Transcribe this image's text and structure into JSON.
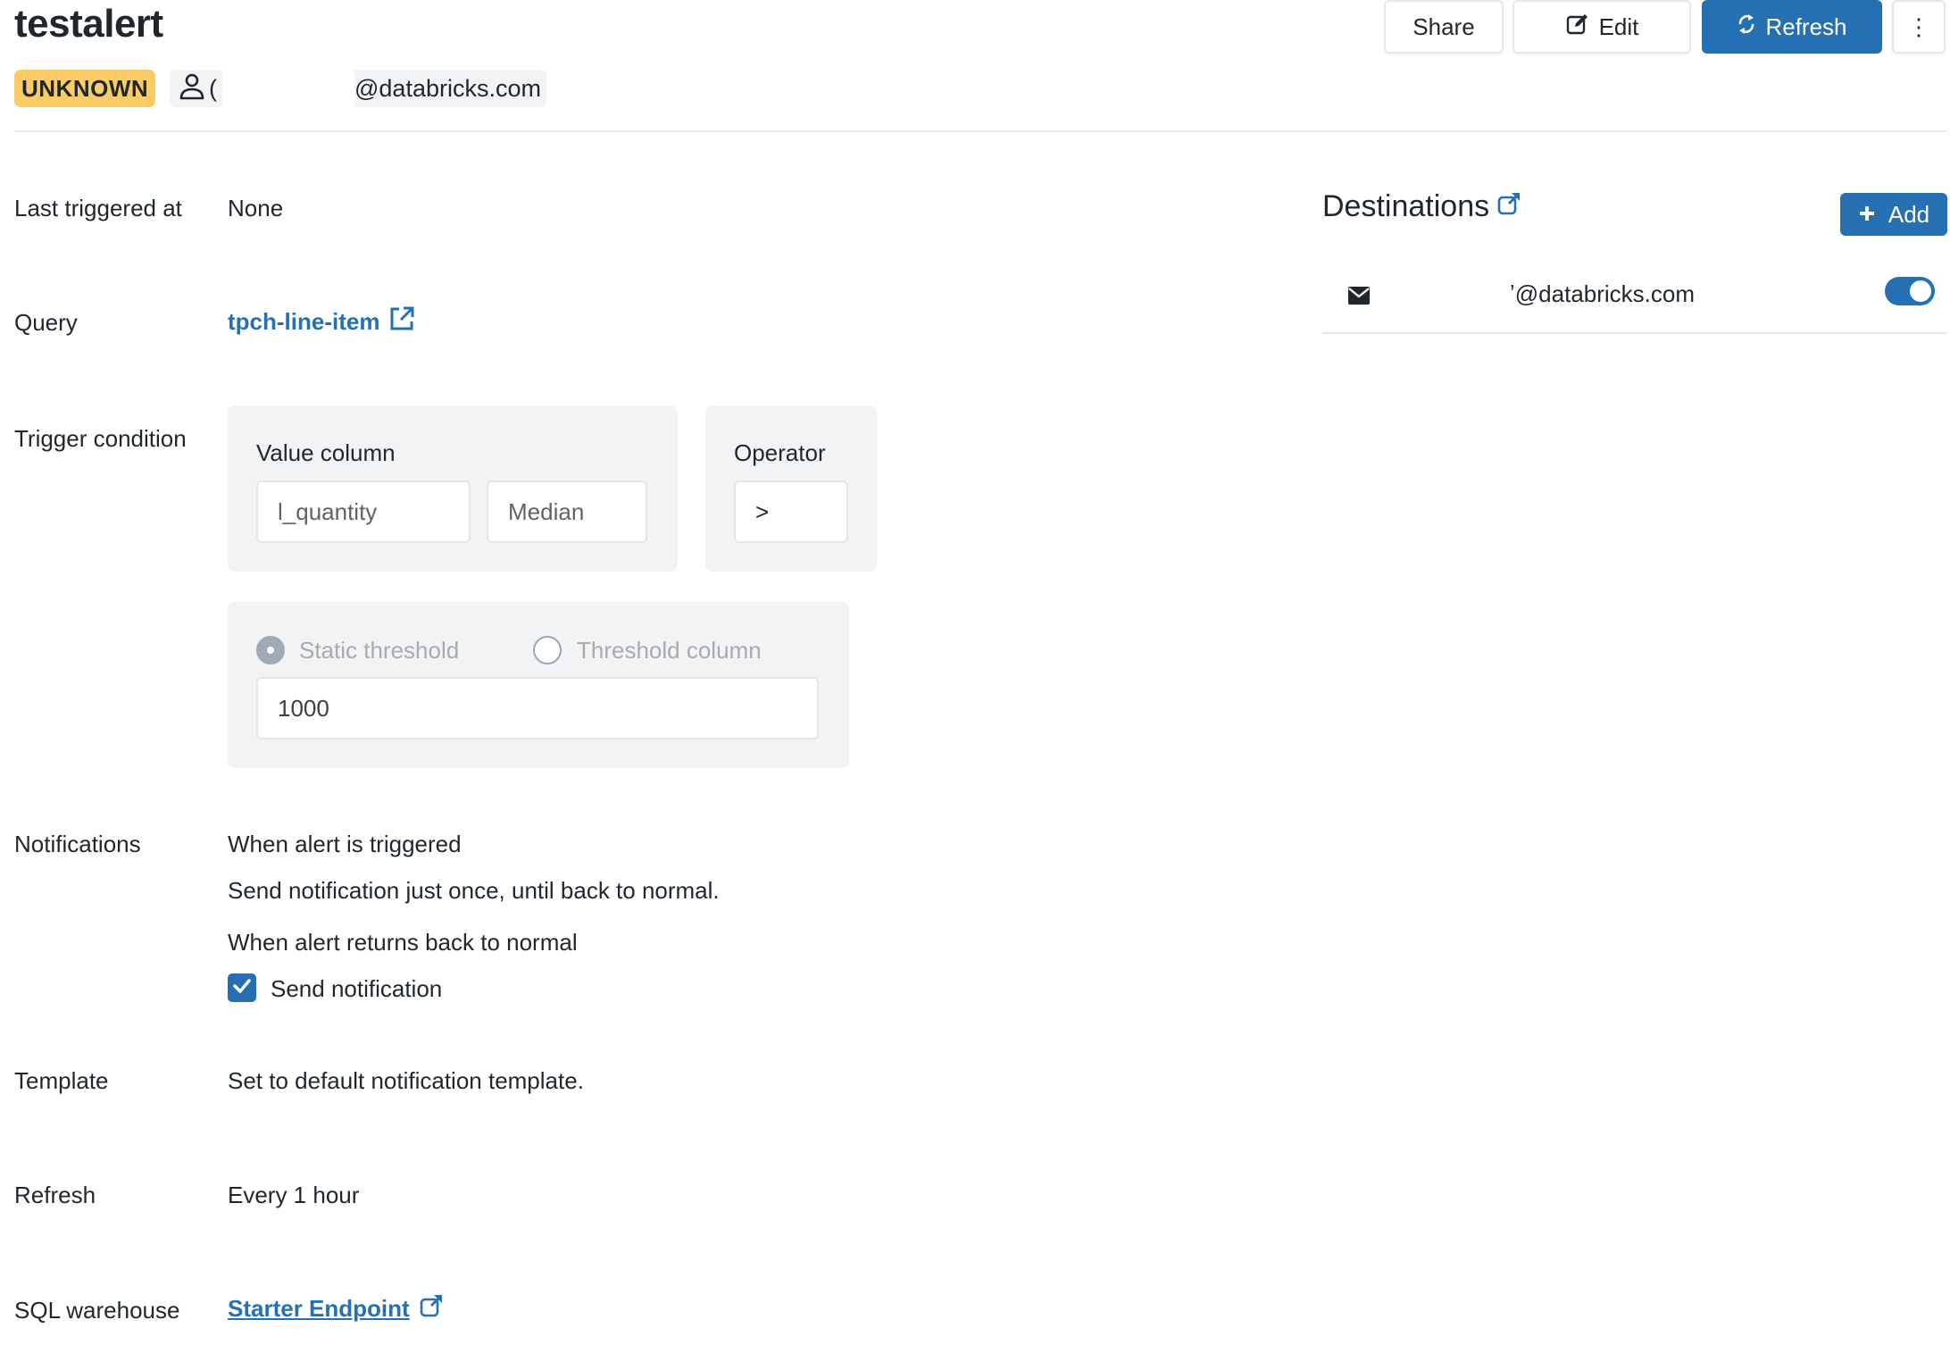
{
  "header": {
    "title": "testalert",
    "status_badge": "UNKNOWN",
    "owner_prefix": "(",
    "owner_email_suffix": "@databricks.com",
    "buttons": {
      "share": "Share",
      "edit": "Edit",
      "refresh": "Refresh",
      "more": "⋮"
    }
  },
  "details": {
    "last_triggered": {
      "label": "Last triggered at",
      "value": "None"
    },
    "query": {
      "label": "Query",
      "value": "tpch-line-item"
    },
    "trigger_condition": {
      "label": "Trigger condition",
      "value_column_label": "Value column",
      "value_column": "l_quantity",
      "aggregation": "Median",
      "operator_label": "Operator",
      "operator": ">",
      "threshold_options": [
        {
          "label": "Static threshold",
          "selected": true
        },
        {
          "label": "Threshold column",
          "selected": false
        }
      ],
      "threshold_value": "1000"
    },
    "notifications": {
      "label": "Notifications",
      "triggered_heading": "When alert is triggered",
      "triggered_text": "Send notification just once, until back to normal.",
      "normal_heading": "When alert returns back to normal",
      "send_notification_label": "Send notification",
      "send_notification_checked": true
    },
    "template": {
      "label": "Template",
      "value": "Set to default notification template."
    },
    "refresh": {
      "label": "Refresh",
      "value": "Every 1 hour"
    },
    "sql_warehouse": {
      "label": "SQL warehouse",
      "value": "Starter Endpoint"
    }
  },
  "destinations": {
    "title": "Destinations",
    "add_label": "Add",
    "items": [
      {
        "type": "email",
        "address": "r@databricks.com",
        "enabled": true
      }
    ]
  },
  "colors": {
    "accent": "#2470b3",
    "badge_unknown": "#fbcb66",
    "panel_bg": "#f2f3f5",
    "text": "#1f272d"
  }
}
